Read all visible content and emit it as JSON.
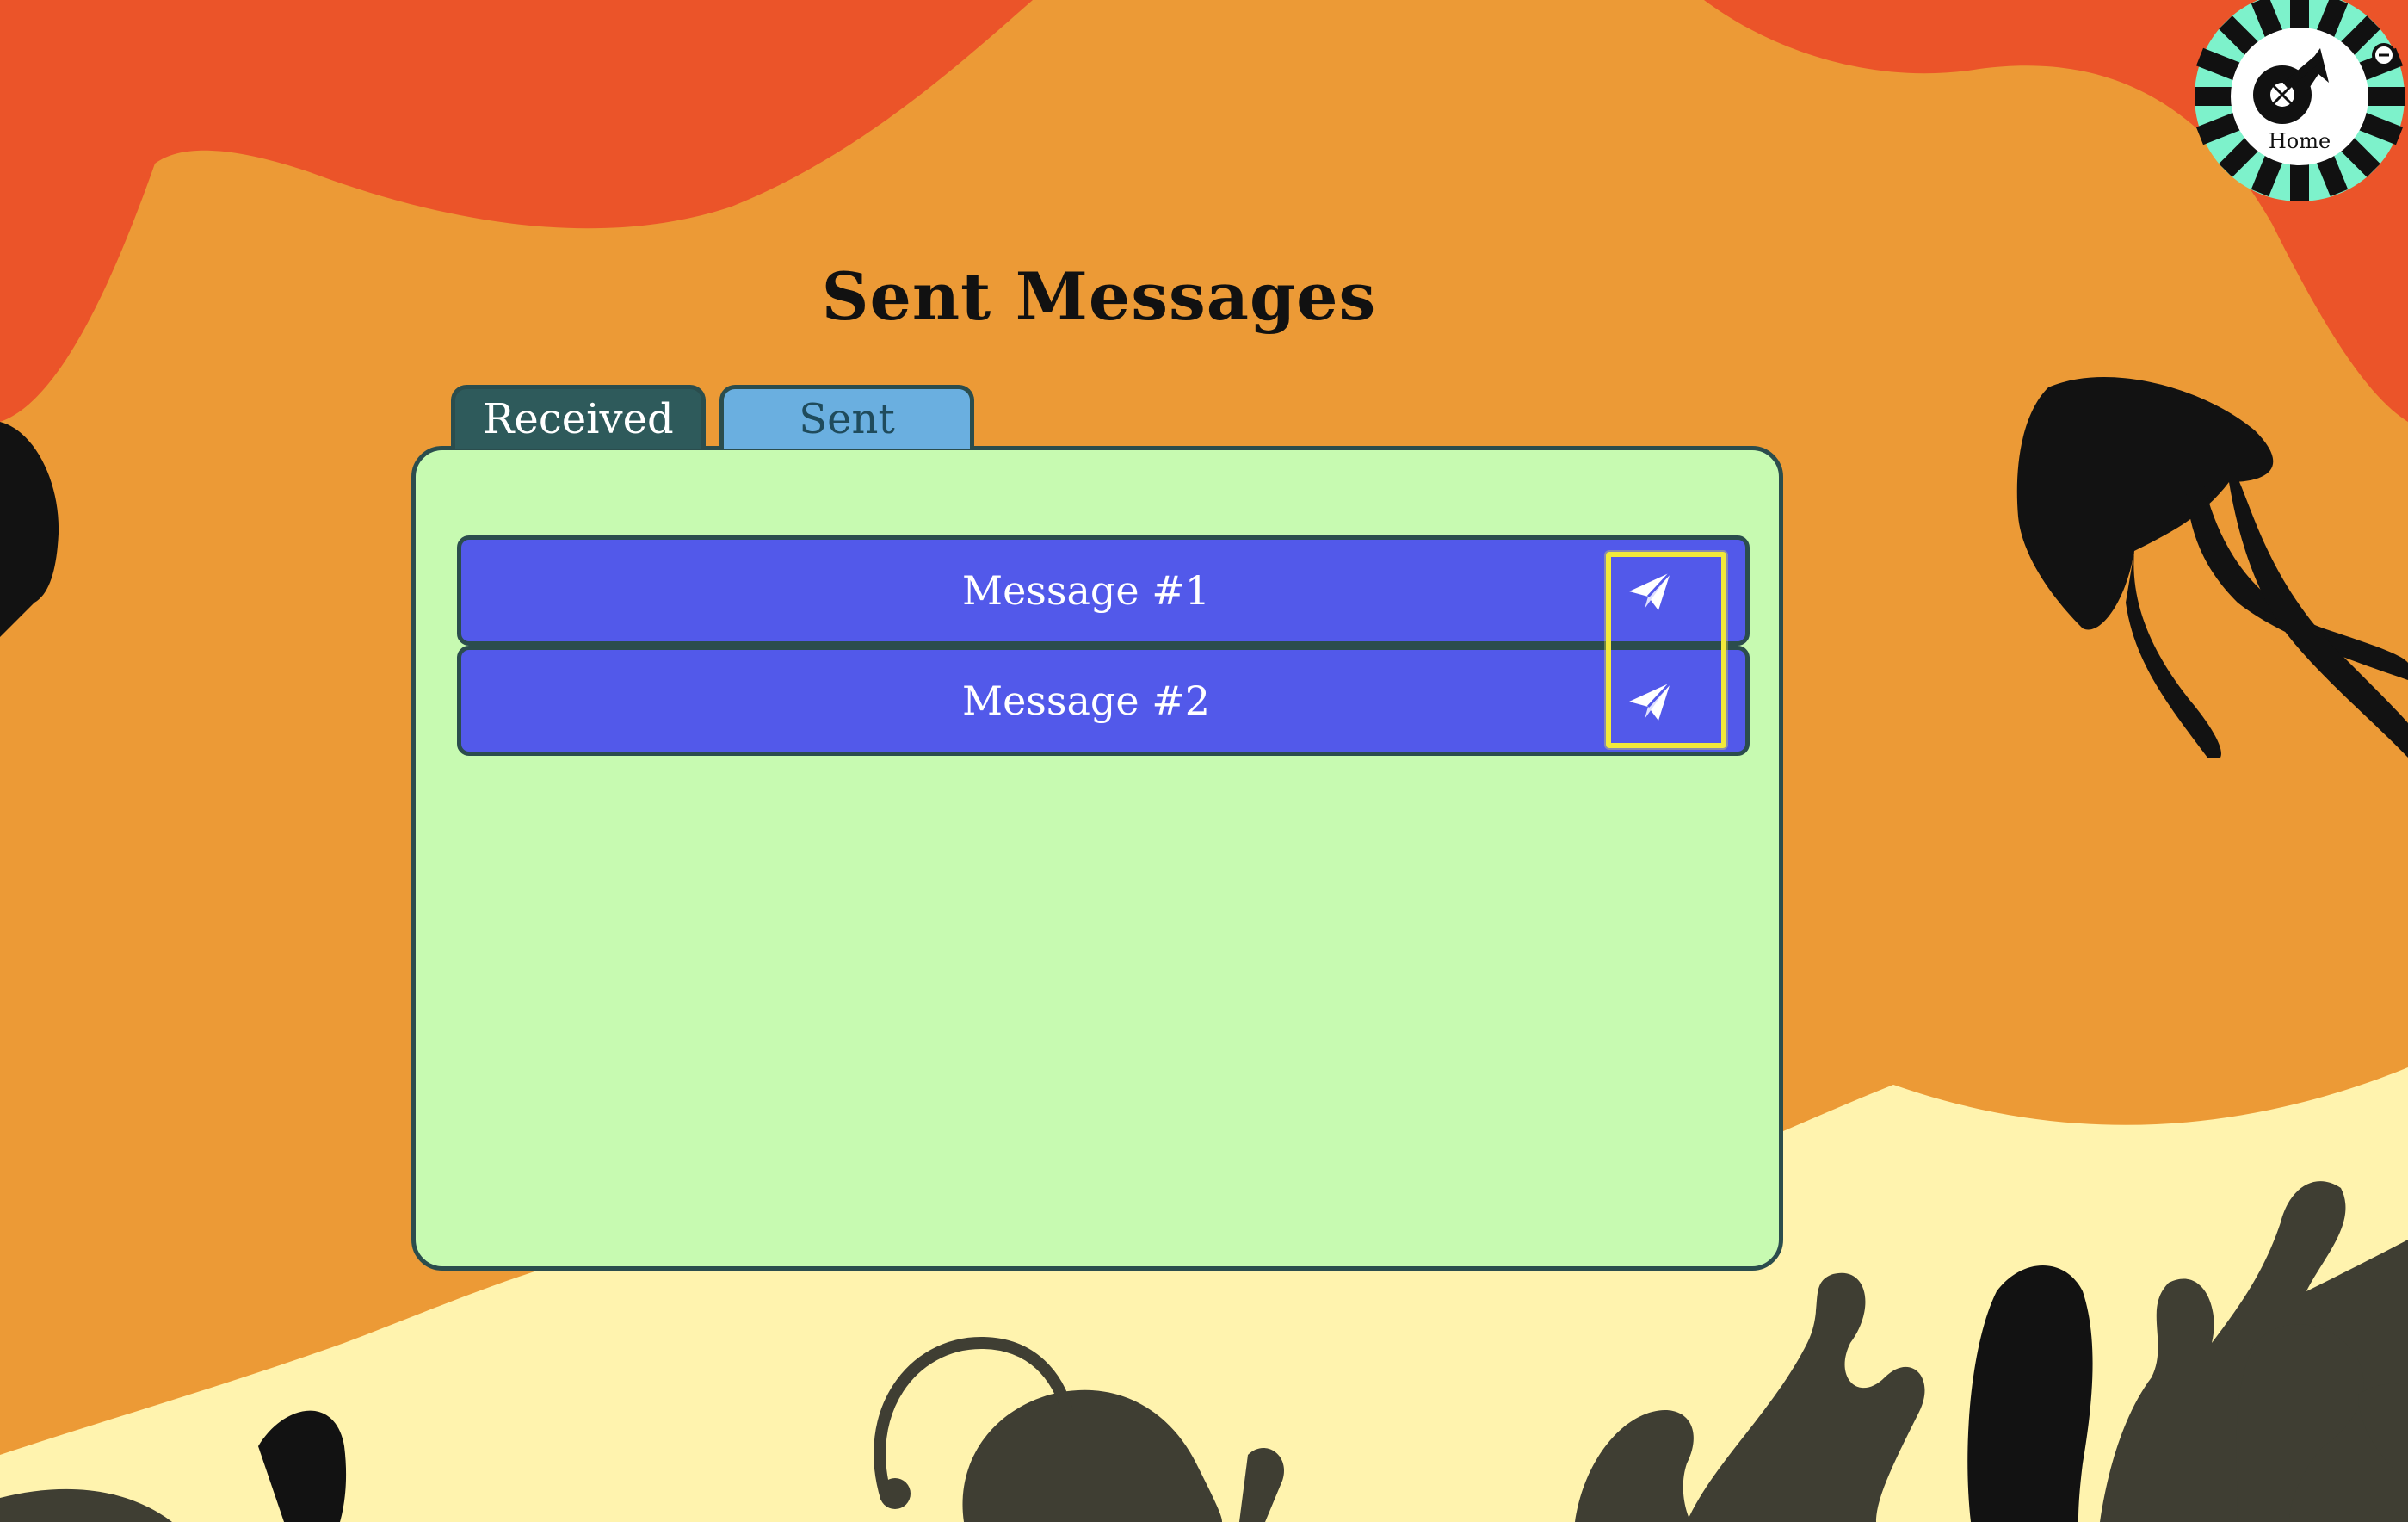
{
  "page": {
    "title": "Sent Messages"
  },
  "tabs": [
    {
      "label": "Received",
      "active": true
    },
    {
      "label": "Sent",
      "active": false
    }
  ],
  "messages": [
    {
      "label": "Message #1",
      "icon": "send-icon"
    },
    {
      "label": "Message #2",
      "icon": "send-icon"
    }
  ],
  "home": {
    "label": "Home",
    "icon": "home-ship-wheel-icon"
  },
  "colors": {
    "background_top": "#eb5429",
    "background_mid": "#ec9a36",
    "sand": "#fff3ae",
    "panel": "#c7fab1",
    "message_button": "#5259ea",
    "tab_active": "#2e5a5b",
    "tab_inactive": "#6aafe0",
    "highlight": "#f2ea3a",
    "wheel_accent": "#7df2cb"
  }
}
